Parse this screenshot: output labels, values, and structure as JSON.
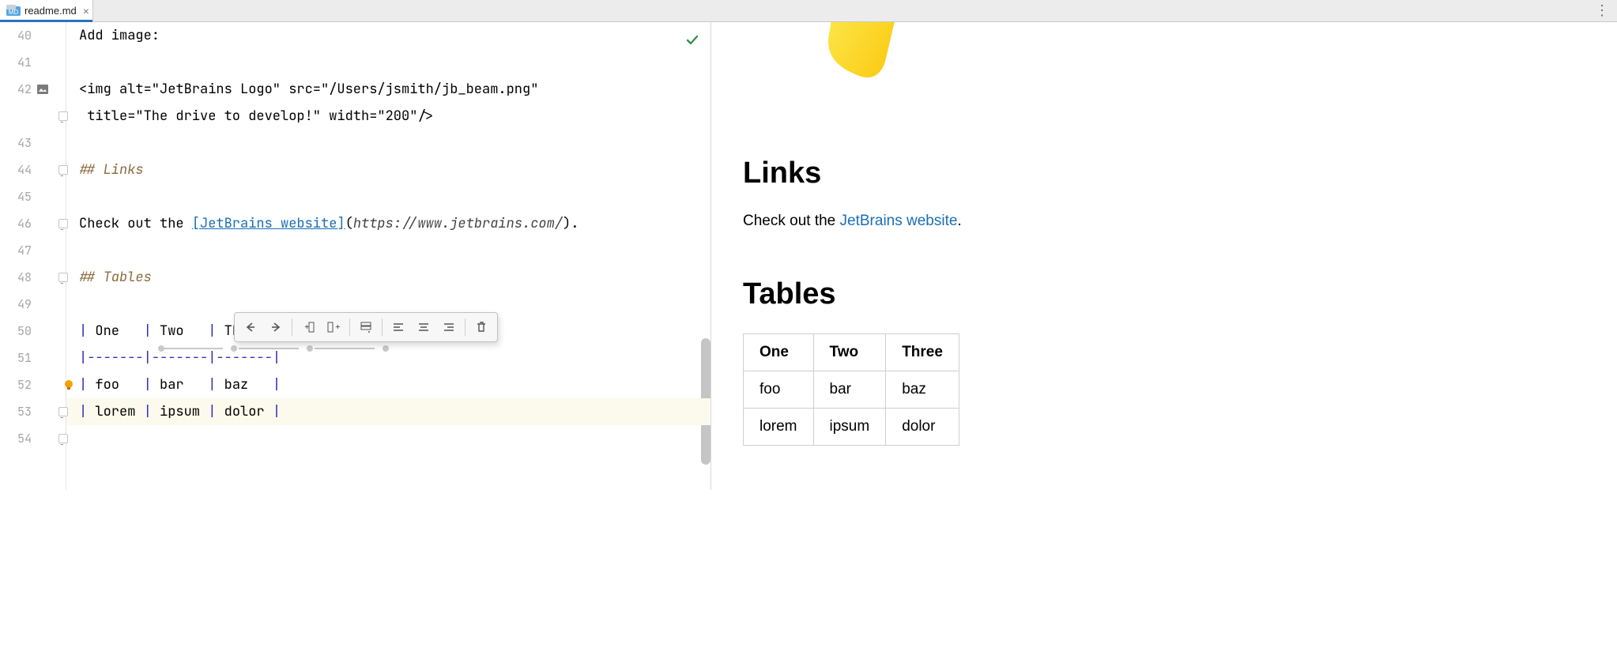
{
  "tab": {
    "filename": "readme.md"
  },
  "toolbar_icons": [
    "arrow-left",
    "arrow-right",
    "insert-col-left",
    "insert-col-right",
    "insert-row",
    "align-left",
    "align-center",
    "align-right",
    "delete"
  ],
  "gutter": [
    {
      "n": "40"
    },
    {
      "n": "41"
    },
    {
      "n": "42",
      "icon": "image"
    },
    {
      "n": ""
    },
    {
      "n": "43"
    },
    {
      "n": "44"
    },
    {
      "n": "45"
    },
    {
      "n": "46"
    },
    {
      "n": "47"
    },
    {
      "n": "48"
    },
    {
      "n": "49"
    },
    {
      "n": "50"
    },
    {
      "n": "51"
    },
    {
      "n": "52"
    },
    {
      "n": "53"
    },
    {
      "n": "54"
    }
  ],
  "code": {
    "l40": "Add image:",
    "l42a": "<img alt=\"JetBrains Logo\" src=\"/Users/jsmith/jb_beam.png\"",
    "l42b": " title=\"The drive to develop!\" width=\"200\"/>",
    "l44_prefix": "## ",
    "l44_title": "Links",
    "l46_pre": "Check out the ",
    "l46_link": "[JetBrains website]",
    "l46_open": "(",
    "l46_url": "https://www.jetbrains.com/",
    "l46_close": ")",
    "l46_dot": ".",
    "l48_prefix": "## ",
    "l48_title": "Tables",
    "table_src": {
      "p": "|",
      "cells": {
        "r0c0": " One   ",
        "r0c1": " Two   ",
        "r0c2": " Three ",
        "r2c0": " foo   ",
        "r2c1": " bar   ",
        "r2c2": " baz   ",
        "r3c0": " lorem ",
        "r3c1": " ipsum ",
        "r3c2": " dolor "
      },
      "dash": "-------"
    }
  },
  "preview": {
    "h_links": "Links",
    "p_pre": "Check out the ",
    "p_link": "JetBrains website",
    "p_post": ".",
    "h_tables": "Tables",
    "table": {
      "headers": [
        "One",
        "Two",
        "Three"
      ],
      "rows": [
        [
          "foo",
          "bar",
          "baz"
        ],
        [
          "lorem",
          "ipsum",
          "dolor"
        ]
      ]
    }
  }
}
